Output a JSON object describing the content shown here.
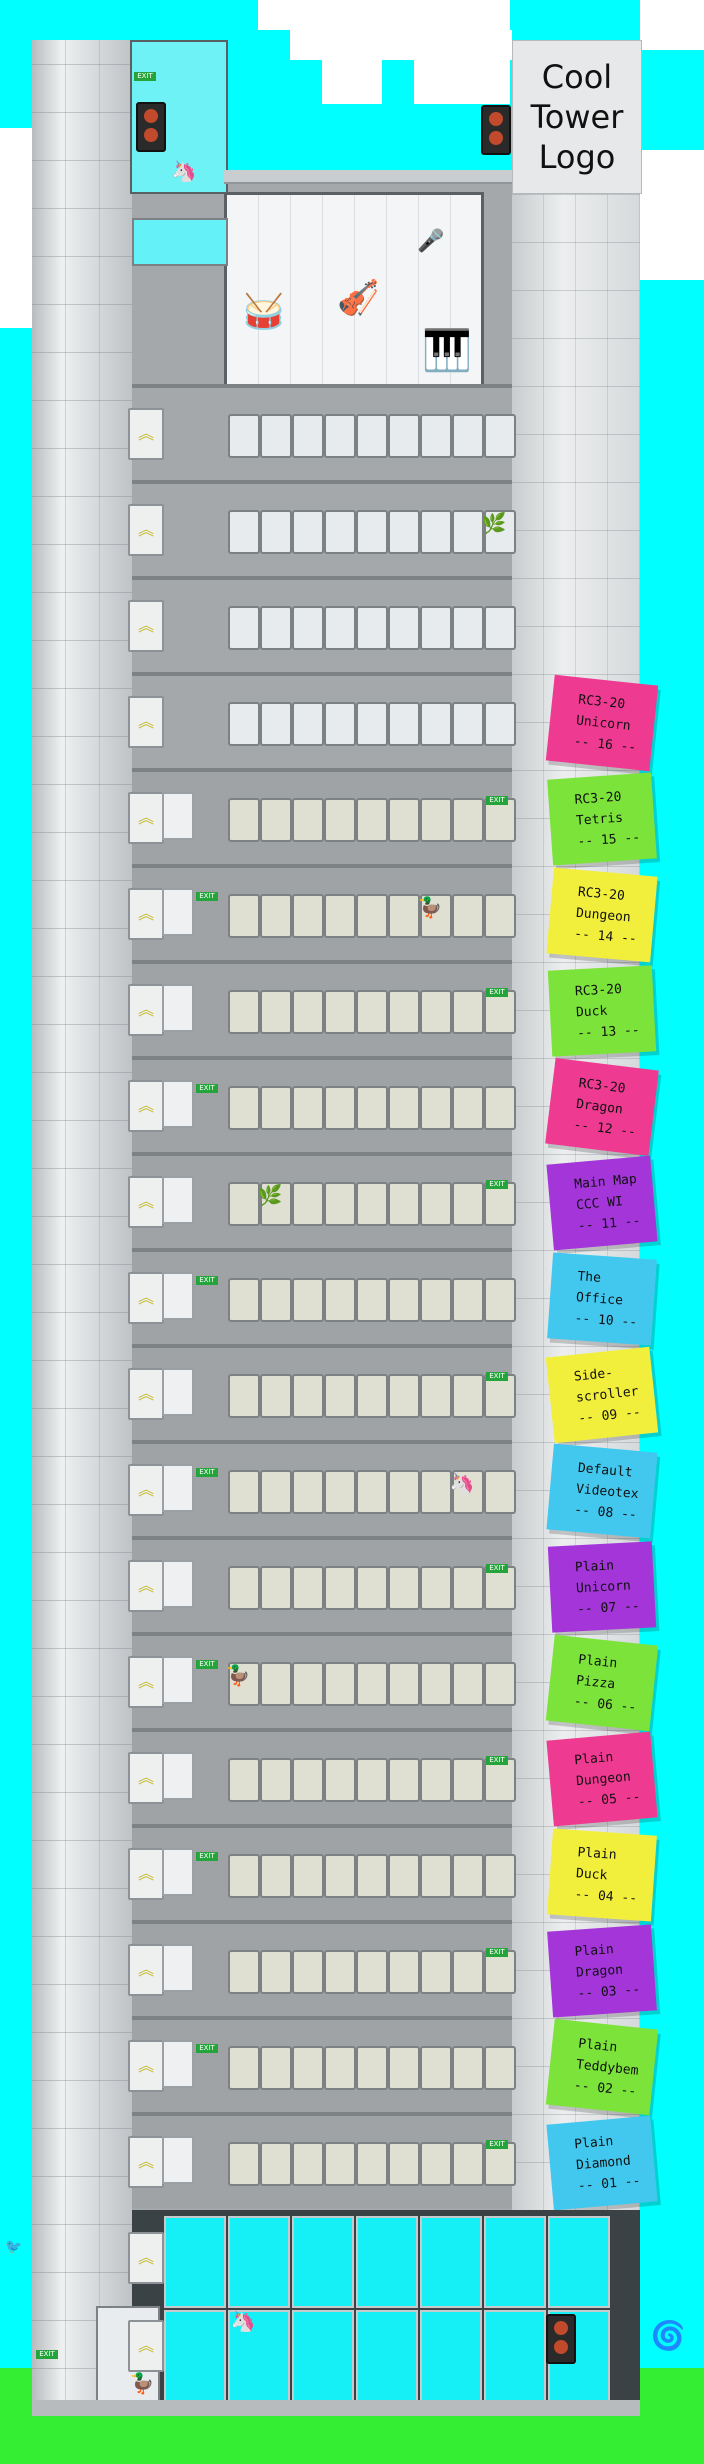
{
  "logo": {
    "text": "Cool\nTower\nLogo"
  },
  "colors": {
    "sky": "#00ffff",
    "grass": "#33ee33",
    "note_pink": "#ef3a92",
    "note_green": "#7be33a",
    "note_yellow": "#f2ef3c",
    "note_purple": "#a335d9",
    "note_blue": "#42c8ef"
  },
  "music_room": {
    "instruments": [
      "drum-kit-icon",
      "double-bass-icon",
      "microphone-stand-icon",
      "grand-piano-icon"
    ]
  },
  "exit_label": "EXIT",
  "floors": [
    {
      "label": "RC3-20\nUnicorn\n-- 16 --",
      "color": "pink"
    },
    {
      "label": "RC3-20\nTetris\n-- 15 --",
      "color": "green"
    },
    {
      "label": "RC3-20\nDungeon\n-- 14 --",
      "color": "yellow"
    },
    {
      "label": "RC3-20\nDuck\n-- 13 --",
      "color": "green"
    },
    {
      "label": "RC3-20\nDragon\n-- 12 --",
      "color": "pink"
    },
    {
      "label": "Main Map\nCCC WI\n-- 11 --",
      "color": "purple"
    },
    {
      "label": "The\nOffice\n-- 10 --",
      "color": "blue"
    },
    {
      "label": "Side-\nscroller\n-- 09 --",
      "color": "yellow"
    },
    {
      "label": "Default\nVideotex\n-- 08 --",
      "color": "blue"
    },
    {
      "label": "Plain\nUnicorn\n-- 07 --",
      "color": "purple"
    },
    {
      "label": "Plain\nPizza\n-- 06 --",
      "color": "green"
    },
    {
      "label": "Plain\nDungeon\n-- 05 --",
      "color": "pink"
    },
    {
      "label": "Plain\nDuck\n-- 04 --",
      "color": "yellow"
    },
    {
      "label": "Plain\nDragon\n-- 03 --",
      "color": "purple"
    },
    {
      "label": "Plain\nTeddybem\n-- 02 --",
      "color": "green"
    },
    {
      "label": "Plain\nDiamond\n-- 01 --",
      "color": "blue"
    }
  ]
}
